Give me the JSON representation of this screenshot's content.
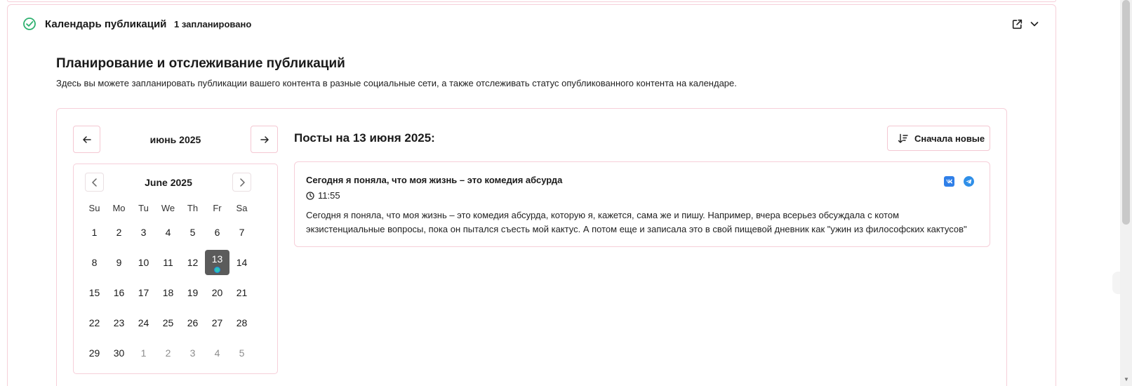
{
  "panel": {
    "title": "Календарь публикаций",
    "scheduled_count": "1 запланировано",
    "icons": {
      "status": "check-circle-icon",
      "open": "external-link-icon",
      "collapse": "chevron-down-icon"
    }
  },
  "section": {
    "title": "Планирование и отслеживание публикаций",
    "description": "Здесь вы можете запланировать публикации вашего контента в разные социальные сети, а также отслеживать статус опубликованного контента на календаре."
  },
  "month_nav": {
    "label": "июнь 2025",
    "prev_icon": "arrow-left-icon",
    "next_icon": "arrow-right-icon"
  },
  "calendar": {
    "title": "June 2025",
    "weekdays": [
      "Su",
      "Mo",
      "Tu",
      "We",
      "Th",
      "Fr",
      "Sa"
    ],
    "days": [
      "1",
      "2",
      "3",
      "4",
      "5",
      "6",
      "7",
      "8",
      "9",
      "10",
      "11",
      "12",
      "13",
      "14",
      "15",
      "16",
      "17",
      "18",
      "19",
      "20",
      "21",
      "22",
      "23",
      "24",
      "25",
      "26",
      "27",
      "28",
      "29",
      "30",
      "1",
      "2",
      "3",
      "4",
      "5"
    ],
    "selected_day": "13",
    "days_with_posts": [
      "13"
    ]
  },
  "posts": {
    "heading": "Посты на 13 июня 2025:",
    "sort_label": "Сначала новые",
    "items": [
      {
        "title": "Сегодня я поняла, что моя жизнь – это комедия абсурда",
        "time": "11:55",
        "body_line1": "Сегодня я поняла, что моя жизнь – это комедия абсурда, которую я, кажется, сама же и пишу. Например, вчера всерьез обсуждала с котом",
        "body_line2": "экзистенциальные вопросы, пока он пытался съесть мой кактус. А потом еще и записала это в свой пищевой дневник как \"ужин из философских кактусов\"",
        "platforms": [
          "vk-icon",
          "telegram-icon"
        ]
      }
    ]
  },
  "colors": {
    "border_pink": "#f6cfd9",
    "check_green": "#2fb170",
    "selected_bg": "#5b5b5b",
    "dot_teal": "#2ec4b6",
    "vk_blue": "#2f7fe8",
    "telegram_blue": "#2f8fe8"
  }
}
